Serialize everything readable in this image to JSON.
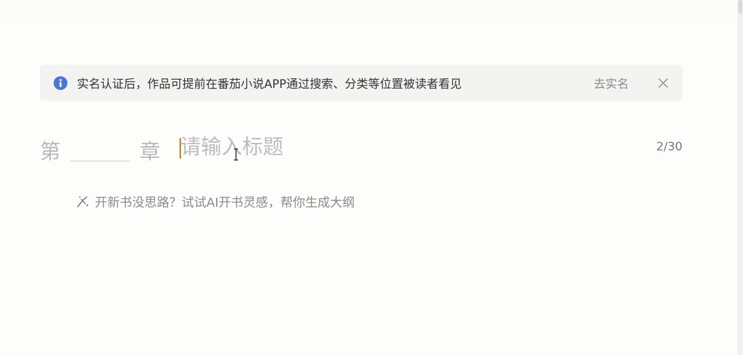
{
  "notice": {
    "icon": "info-icon",
    "text": "实名认证后，作品可提前在番茄小说APP通过搜索、分类等位置被读者看见",
    "action_label": "去实名",
    "close_icon": "close-icon",
    "accent_color": "#4a76d6"
  },
  "chapter": {
    "prefix": "第",
    "number_value": "",
    "suffix": "章",
    "title_placeholder": "请输入标题",
    "title_value": "",
    "char_count": "2/30",
    "caret_color": "#e0771f"
  },
  "ai_hint": {
    "icon": "magic-wand-icon",
    "text": "开新书没思路？试试AI开书灵感，帮你生成大纲"
  }
}
